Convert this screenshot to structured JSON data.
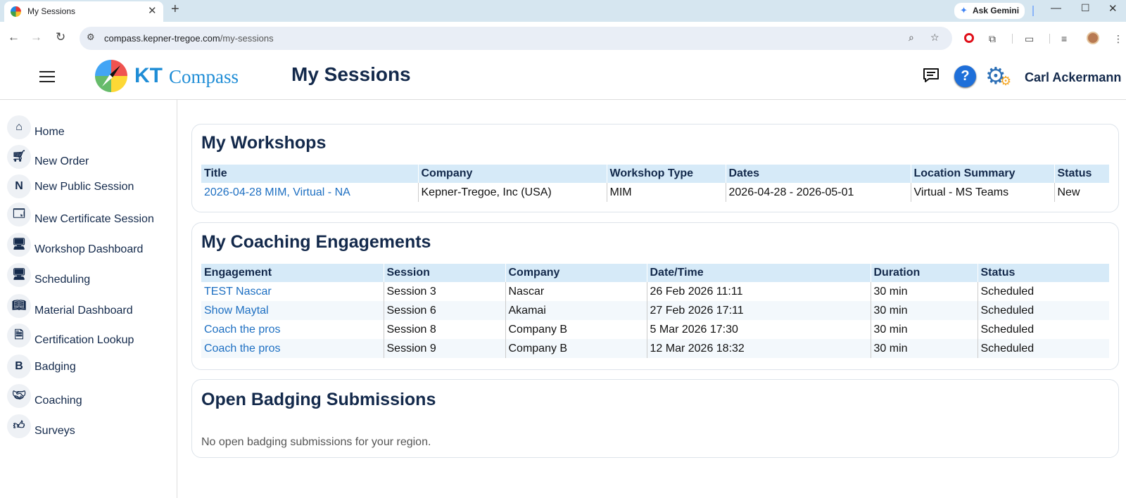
{
  "browser": {
    "tab_title": "My Sessions",
    "url_host": "compass.kepner-tregoe.com",
    "url_path": "/my-sessions",
    "ask_gemini": "Ask Gemini"
  },
  "header": {
    "logo_kt": "KT",
    "logo_compass": "Compass",
    "page_title": "My Sessions",
    "user_name": "Carl Ackermann",
    "help_glyph": "?"
  },
  "sidebar": {
    "items": [
      {
        "label": "Home",
        "icon": "home-icon"
      },
      {
        "label": "New Order",
        "icon": "cart-icon"
      },
      {
        "label": "New Public Session",
        "icon": "n-letter-icon",
        "glyph": "N"
      },
      {
        "label": "New Certificate Session",
        "icon": "certificate-icon"
      },
      {
        "label": "Workshop Dashboard",
        "icon": "monitor-icon"
      },
      {
        "label": "Scheduling",
        "icon": "monitor-icon"
      },
      {
        "label": "Material Dashboard",
        "icon": "book-icon"
      },
      {
        "label": "Certification Lookup",
        "icon": "document-search-icon"
      },
      {
        "label": "Badging",
        "icon": "b-letter-icon",
        "glyph": "B"
      },
      {
        "label": "Coaching",
        "icon": "handshake-icon"
      },
      {
        "label": "Surveys",
        "icon": "thumbs-up-icon"
      }
    ]
  },
  "workshops": {
    "title": "My Workshops",
    "columns": [
      "Title",
      "Company",
      "Workshop Type",
      "Dates",
      "Location Summary",
      "Status"
    ],
    "rows": [
      [
        "2026-04-28 MIM, Virtual - NA",
        "Kepner-Tregoe, Inc (USA)",
        "MIM",
        "2026-04-28 - 2026-05-01",
        "Virtual - MS Teams",
        "New"
      ]
    ]
  },
  "coaching": {
    "title": "My Coaching Engagements",
    "columns": [
      "Engagement",
      "Session",
      "Company",
      "Date/Time",
      "Duration",
      "Status"
    ],
    "rows": [
      [
        "TEST Nascar",
        "Session 3",
        "Nascar",
        "26 Feb 2026 11:11",
        "30 min",
        "Scheduled"
      ],
      [
        "Show Maytal",
        "Session 6",
        "Akamai",
        "27 Feb 2026 17:11",
        "30 min",
        "Scheduled"
      ],
      [
        "Coach the pros",
        "Session 8",
        "Company B",
        "5 Mar 2026 17:30",
        "30 min",
        "Scheduled"
      ],
      [
        "Coach the pros",
        "Session 9",
        "Company B",
        "12 Mar 2026 18:32",
        "30 min",
        "Scheduled"
      ]
    ]
  },
  "badging": {
    "title": "Open Badging Submissions",
    "empty_text": "No open badging submissions for your region."
  },
  "colors": {
    "accent": "#1f8dd6",
    "heading": "#13294b",
    "link": "#1d6fc2",
    "table_header": "#d6eaf8"
  }
}
